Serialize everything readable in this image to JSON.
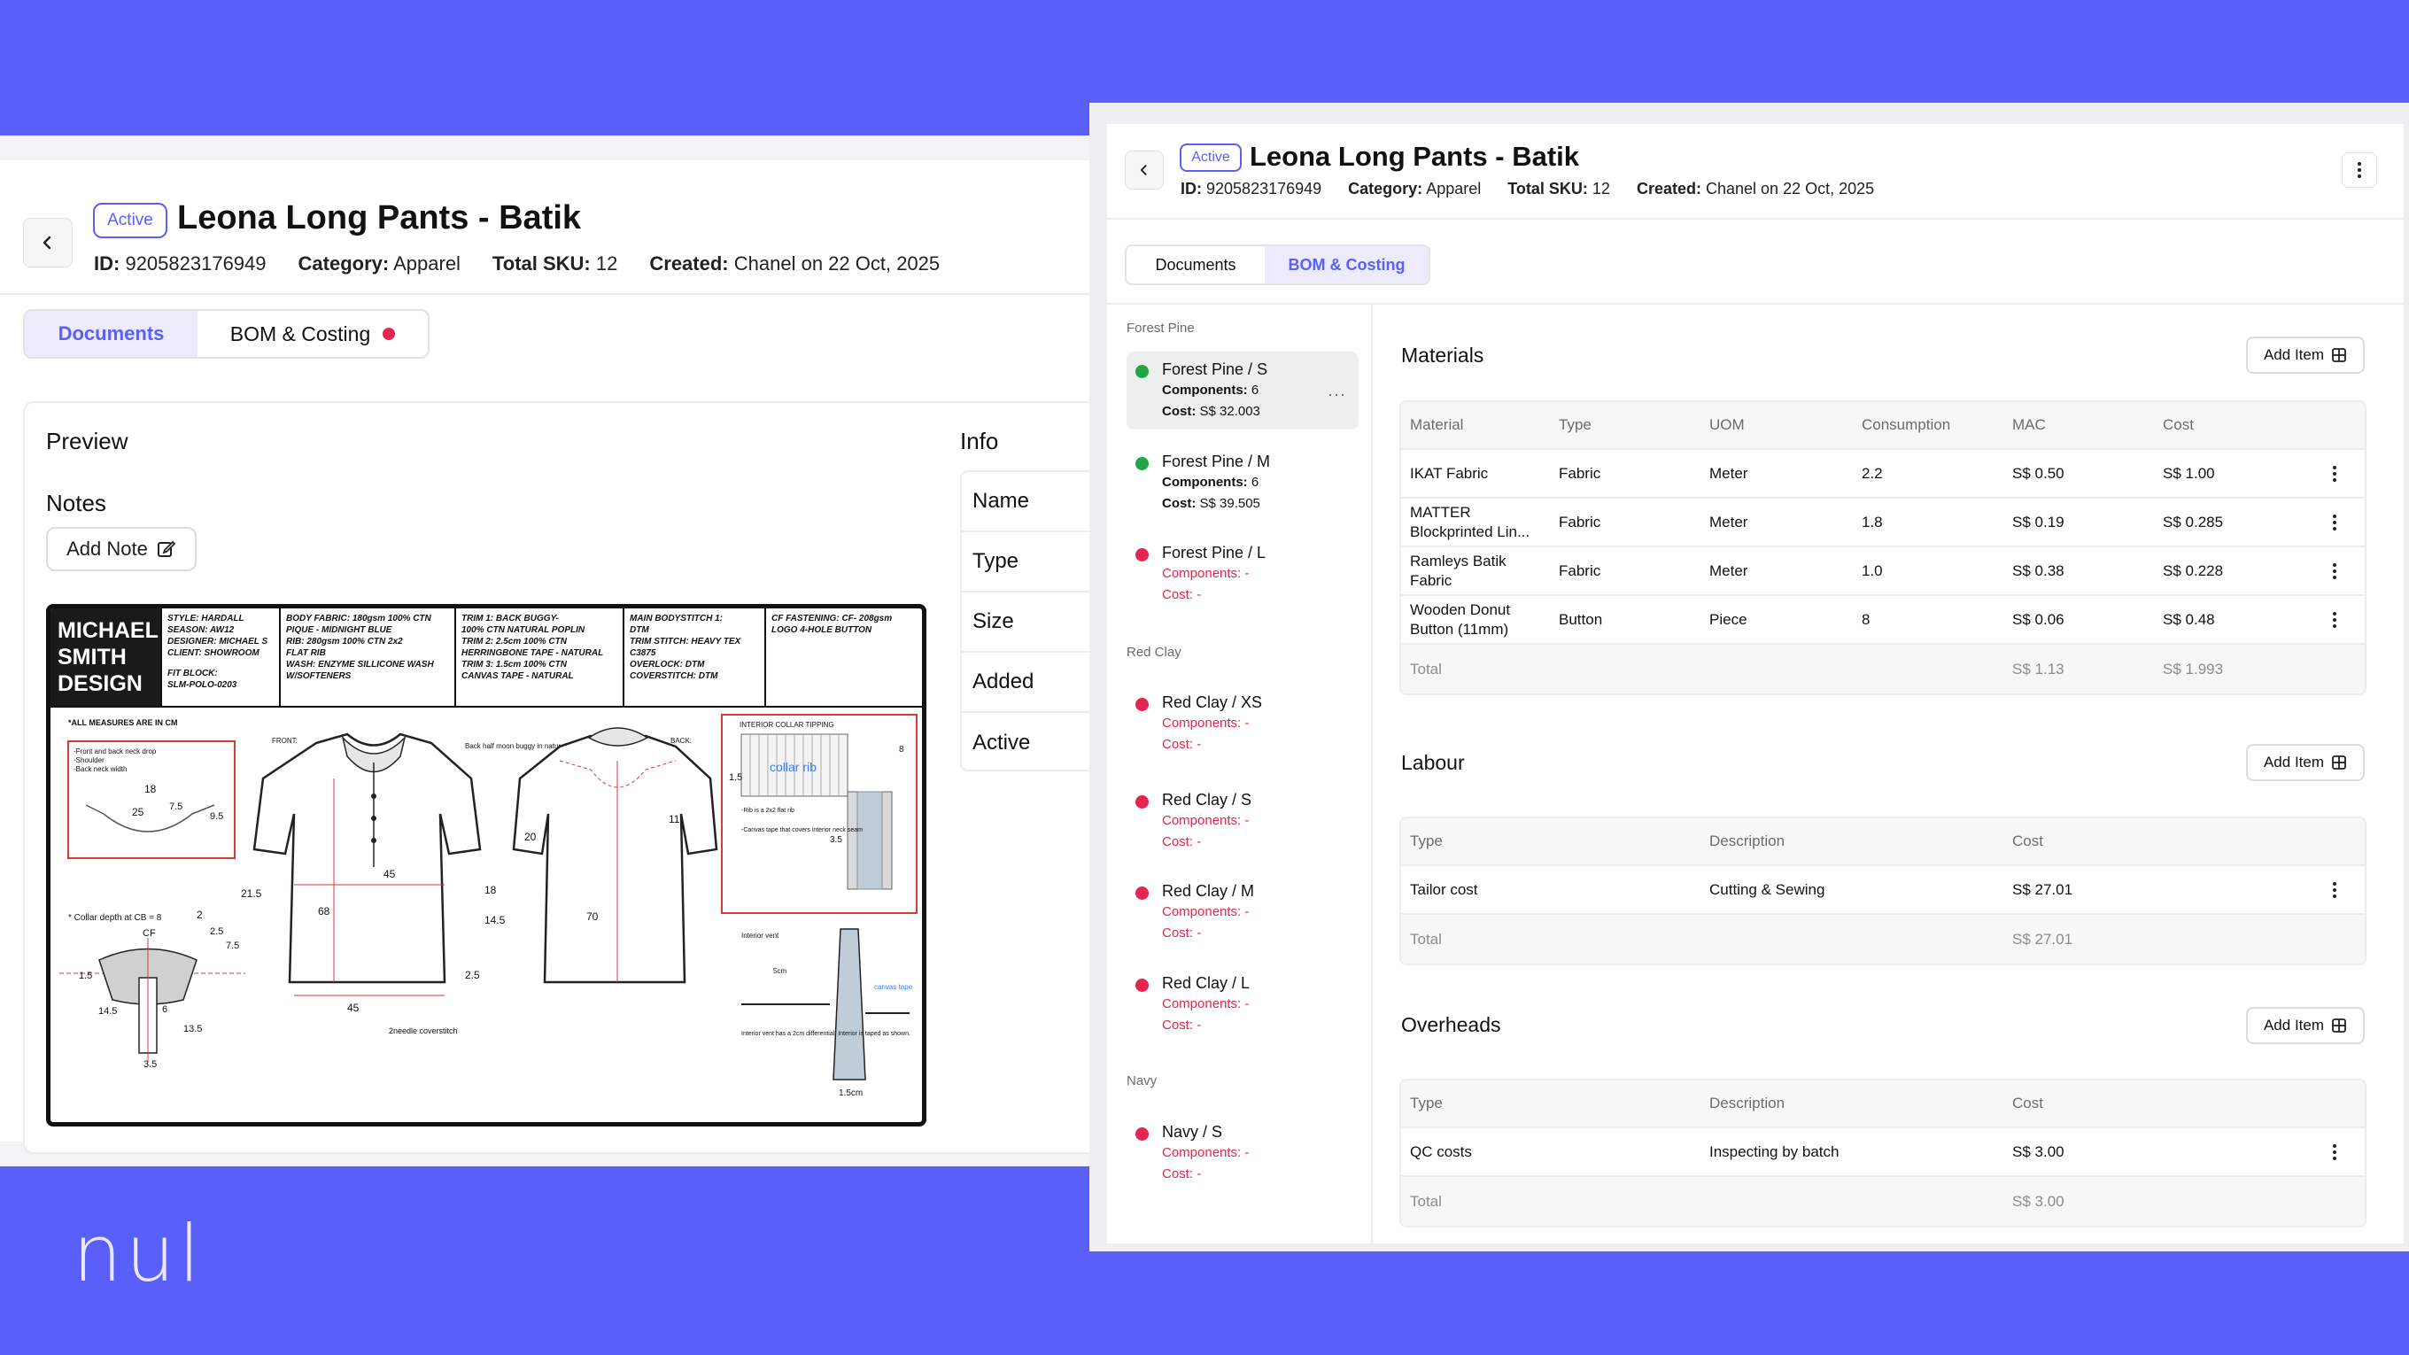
{
  "left": {
    "status": "Active",
    "title": "Leona Long Pants - Batik",
    "meta": {
      "id_label": "ID:",
      "id_value": "9205823176949",
      "category_label": "Category:",
      "category_value": "Apparel",
      "sku_label": "Total SKU:",
      "sku_value": "12",
      "created_label": "Created:",
      "created_value": "Chanel on 22 Oct, 2025"
    },
    "tabs": [
      "Documents",
      "BOM & Costing"
    ],
    "preview_label": "Preview",
    "notes_label": "Notes",
    "add_note": "Add Note",
    "info_label": "Info",
    "info_rows": [
      "Name",
      "Type",
      "Size",
      "Added",
      "Active"
    ]
  },
  "sheet": {
    "logo": [
      "MICHAEL",
      "SMITH",
      "DESIGN"
    ],
    "col1": [
      "STYLE: HARDALL",
      "SEASON: AW12",
      "DESIGNER: MICHAEL S",
      "CLIENT: SHOWROOM",
      "FIT BLOCK:",
      "SLM-POLO-0203"
    ],
    "col2": [
      "BODY FABRIC: 180gsm 100% CTN",
      "PIQUE - MIDNIGHT BLUE",
      "RIB: 280gsm 100% CTN 2x2",
      "FLAT RIB",
      "WASH: ENZYME SILLICONE WASH",
      "W/SOFTENERS"
    ],
    "col3": [
      "TRIM 1: BACK BUGGY-",
      "100% CTN NATURAL POPLIN",
      "TRIM 2: 2.5cm 100% CTN",
      "HERRINGBONE TAPE - NATURAL",
      "TRIM 3: 1.5cm 100% CTN",
      "CANVAS TAPE - NATURAL"
    ],
    "col4": [
      "MAIN BODYSTITCH 1:",
      "DTM",
      "TRIM STITCH: HEAVY TEX",
      "C3875",
      "OVERLOCK: DTM",
      "COVERSTITCH: DTM"
    ],
    "col5": [
      "CF FASTENING: CF- 208gsm",
      "LOGO 4-HOLE BUTTON"
    ],
    "notes": {
      "measures": "*ALL MEASURES ARE IN CM",
      "front": "FRONT:",
      "back": "BACK:",
      "back_note": "Back half moon buggy in natural poplin",
      "collar_tipping": "INTERIOR COLLAR TIPPING",
      "collar_rib": "collar rib",
      "collar_depth": "* Collar depth at CB = 8",
      "interior_vent": "Interior vent",
      "canvas_tape": "canvas tape",
      "coverstitch": "2needle coverstitch",
      "neck_drop": "-Front and back neck drop",
      "shoulder": "-Shoulder",
      "neck_width": "-Back neck width",
      "rib_note": "-Rib is a 2x2 flat rib",
      "canvas_note": "-Canvas tape that covers interior neck seam",
      "vent_note": "Interior vent has a 2cm differential. Interior is taped as shown.",
      "m18": "18",
      "m25": "25",
      "m75": "7.5",
      "m95": "9.5",
      "m2": "2",
      "m215": "21.5",
      "m45": "45",
      "m68": "68",
      "m18b": "18",
      "m20": "20",
      "m11": "11",
      "m70": "70",
      "m145": "14.5",
      "m25b": "2.5",
      "m45b": "45",
      "mcf": "CF",
      "m25c": "2.5",
      "m75b": "7.5",
      "m15": "1.5",
      "m145b": "14.5",
      "m6": "6",
      "m135": "13.5",
      "m35": "3.5",
      "m151": "1.5",
      "m8": "8",
      "m35b": "3.5",
      "m5cm": "5cm",
      "m15cm": "1.5cm"
    }
  },
  "right": {
    "status": "Active",
    "title": "Leona Long Pants - Batik",
    "meta": {
      "id_label": "ID:",
      "id_value": "9205823176949",
      "category_label": "Category:",
      "category_value": "Apparel",
      "sku_label": "Total SKU:",
      "sku_value": "12",
      "created_label": "Created:",
      "created_value": "Chanel on 22 Oct, 2025"
    },
    "tabs": [
      "Documents",
      "BOM & Costing"
    ],
    "groups": [
      "Forest Pine",
      "Red Clay",
      "Navy"
    ],
    "variants": [
      {
        "name": "Forest Pine / S",
        "components_label": "Components:",
        "components": "6",
        "cost_label": "Cost:",
        "cost": "S$ 32.003",
        "status_color": "#22a447",
        "more": "···"
      },
      {
        "name": "Forest Pine / M",
        "components_label": "Components:",
        "components": "6",
        "cost_label": "Cost:",
        "cost": "S$ 39.505",
        "status_color": "#22a447"
      },
      {
        "name": "Forest Pine / L",
        "components_label": "Components:",
        "components": "-",
        "cost_label": "Cost:",
        "cost": "-",
        "status_color": "#e5254f"
      },
      {
        "name": "Red Clay / XS",
        "components_label": "Components:",
        "components": "-",
        "cost_label": "Cost:",
        "cost": "-",
        "status_color": "#e5254f"
      },
      {
        "name": "Red Clay / S",
        "components_label": "Components:",
        "components": "-",
        "cost_label": "Cost:",
        "cost": "-",
        "status_color": "#e5254f"
      },
      {
        "name": "Red Clay / M",
        "components_label": "Components:",
        "components": "-",
        "cost_label": "Cost:",
        "cost": "-",
        "status_color": "#e5254f"
      },
      {
        "name": "Red Clay / L",
        "components_label": "Components:",
        "components": "-",
        "cost_label": "Cost:",
        "cost": "-",
        "status_color": "#e5254f"
      },
      {
        "name": "Navy / S",
        "components_label": "Components:",
        "components": "-",
        "cost_label": "Cost:",
        "cost": "-",
        "status_color": "#e5254f"
      }
    ],
    "add_item": "Add Item",
    "materials": {
      "title": "Materials",
      "headers": [
        "Material",
        "Type",
        "UOM",
        "Consumption",
        "MAC",
        "Cost"
      ],
      "rows": [
        [
          "IKAT Fabric",
          "Fabric",
          "Meter",
          "2.2",
          "S$ 0.50",
          "S$ 1.00"
        ],
        [
          "MATTER Blockprinted Lin...",
          "Fabric",
          "Meter",
          "1.8",
          "S$ 0.19",
          "S$ 0.285"
        ],
        [
          "Ramleys Batik Fabric",
          "Fabric",
          "Meter",
          "1.0",
          "S$ 0.38",
          "S$ 0.228"
        ],
        [
          "Wooden Donut Button (11mm)",
          "Button",
          "Piece",
          "8",
          "S$ 0.06",
          "S$ 0.48"
        ]
      ],
      "total_label": "Total",
      "total_mac": "S$ 1.13",
      "total_cost": "S$ 1.993"
    },
    "labour": {
      "title": "Labour",
      "headers": [
        "Type",
        "Description",
        "Cost"
      ],
      "rows": [
        [
          "Tailor cost",
          "Cutting & Sewing",
          "S$ 27.01"
        ]
      ],
      "total_label": "Total",
      "total_cost": "S$ 27.01"
    },
    "overheads": {
      "title": "Overheads",
      "headers": [
        "Type",
        "Description",
        "Cost"
      ],
      "rows": [
        [
          "QC costs",
          "Inspecting by batch",
          "S$ 3.00"
        ]
      ],
      "total_label": "Total",
      "total_cost": "S$ 3.00"
    }
  },
  "brand": "nul",
  "colors": {
    "accent": "#5a5ffa",
    "success": "#22a447",
    "danger": "#e5254f",
    "background": "#5a5ffa"
  }
}
